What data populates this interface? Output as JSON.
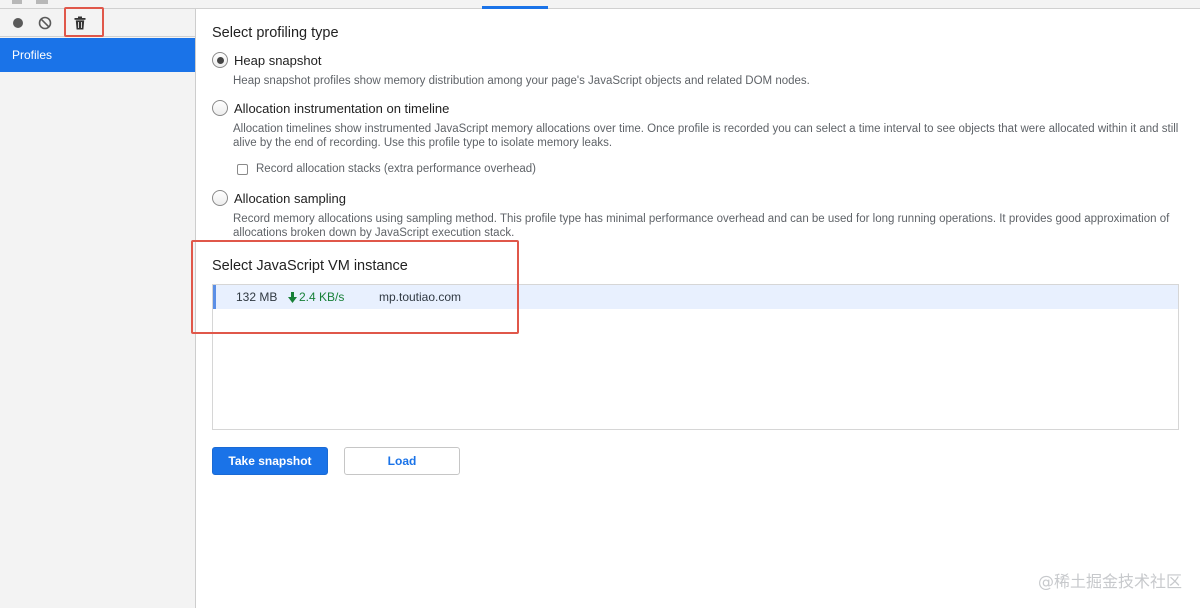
{
  "sidebar": {
    "toolbar": {
      "record_icon": "record-icon",
      "clear_icon": "clear-all-icon",
      "gc_icon": "trash-icon"
    },
    "items": [
      {
        "label": "Profiles"
      }
    ]
  },
  "main": {
    "profiling_type_title": "Select profiling type",
    "options": [
      {
        "label": "Heap snapshot",
        "description": "Heap snapshot profiles show memory distribution among your page's JavaScript objects and related DOM nodes.",
        "checked": true
      },
      {
        "label": "Allocation instrumentation on timeline",
        "description": "Allocation timelines show instrumented JavaScript memory allocations over time. Once profile is recorded you can select a time interval to see objects that were allocated within it and still alive by the end of recording. Use this profile type to isolate memory leaks.",
        "checked": false
      },
      {
        "label": "Allocation sampling",
        "description": "Record memory allocations using sampling method. This profile type has minimal performance overhead and can be used for long running operations. It provides good approximation of allocations broken down by JavaScript execution stack.",
        "checked": false
      }
    ],
    "record_stacks_label": "Record allocation stacks (extra performance overhead)",
    "vm_title": "Select JavaScript VM instance",
    "vm_instances": [
      {
        "size": "132 MB",
        "speed": "2.4 KB/s",
        "url": "mp.toutiao.com"
      }
    ],
    "buttons": {
      "take_snapshot": "Take snapshot",
      "load": "Load"
    }
  },
  "watermark": "@稀土掘金技术社区",
  "colors": {
    "accent": "#1a73e8",
    "highlight": "#e0574a",
    "speed_green": "#188038"
  }
}
